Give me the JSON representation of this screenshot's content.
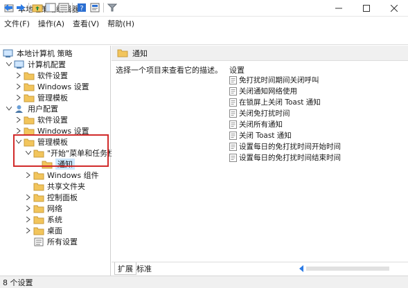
{
  "window": {
    "title": "本地组策略编辑器"
  },
  "menu": [
    "文件(F)",
    "操作(A)",
    "查看(V)",
    "帮助(H)"
  ],
  "tree": {
    "root": "本地计算机 策略",
    "nodes": [
      {
        "label": "计算机配置"
      },
      {
        "label": "软件设置"
      },
      {
        "label": "Windows 设置"
      },
      {
        "label": "管理模板"
      },
      {
        "label": "用户配置"
      },
      {
        "label": "软件设置"
      },
      {
        "label": "Windows 设置"
      },
      {
        "label": "管理模板"
      },
      {
        "label": "\"开始\"菜单和任务栏"
      },
      {
        "label": "通知"
      },
      {
        "label": "Windows 组件"
      },
      {
        "label": "共享文件夹"
      },
      {
        "label": "控制面板"
      },
      {
        "label": "网络"
      },
      {
        "label": "系统"
      },
      {
        "label": "桌面"
      },
      {
        "label": "所有设置"
      }
    ]
  },
  "right": {
    "header": "通知",
    "description": "选择一个项目来查看它的描述。",
    "settings_header": "设置",
    "settings": [
      "免打扰时间期间关闭呼叫",
      "关闭通知网络使用",
      "在锁屏上关闭 Toast 通知",
      "关闭免打扰时间",
      "关闭所有通知",
      "关闭 Toast 通知",
      "设置每日的免打扰时间开始时间",
      "设置每日的免打扰时间结束时间"
    ]
  },
  "tabs": [
    "扩展",
    "标准"
  ],
  "status": "8 个设置",
  "colors": {
    "highlight_box": "#d12a2a",
    "selection": "#cce8ff",
    "folder": "#f2c55c"
  }
}
